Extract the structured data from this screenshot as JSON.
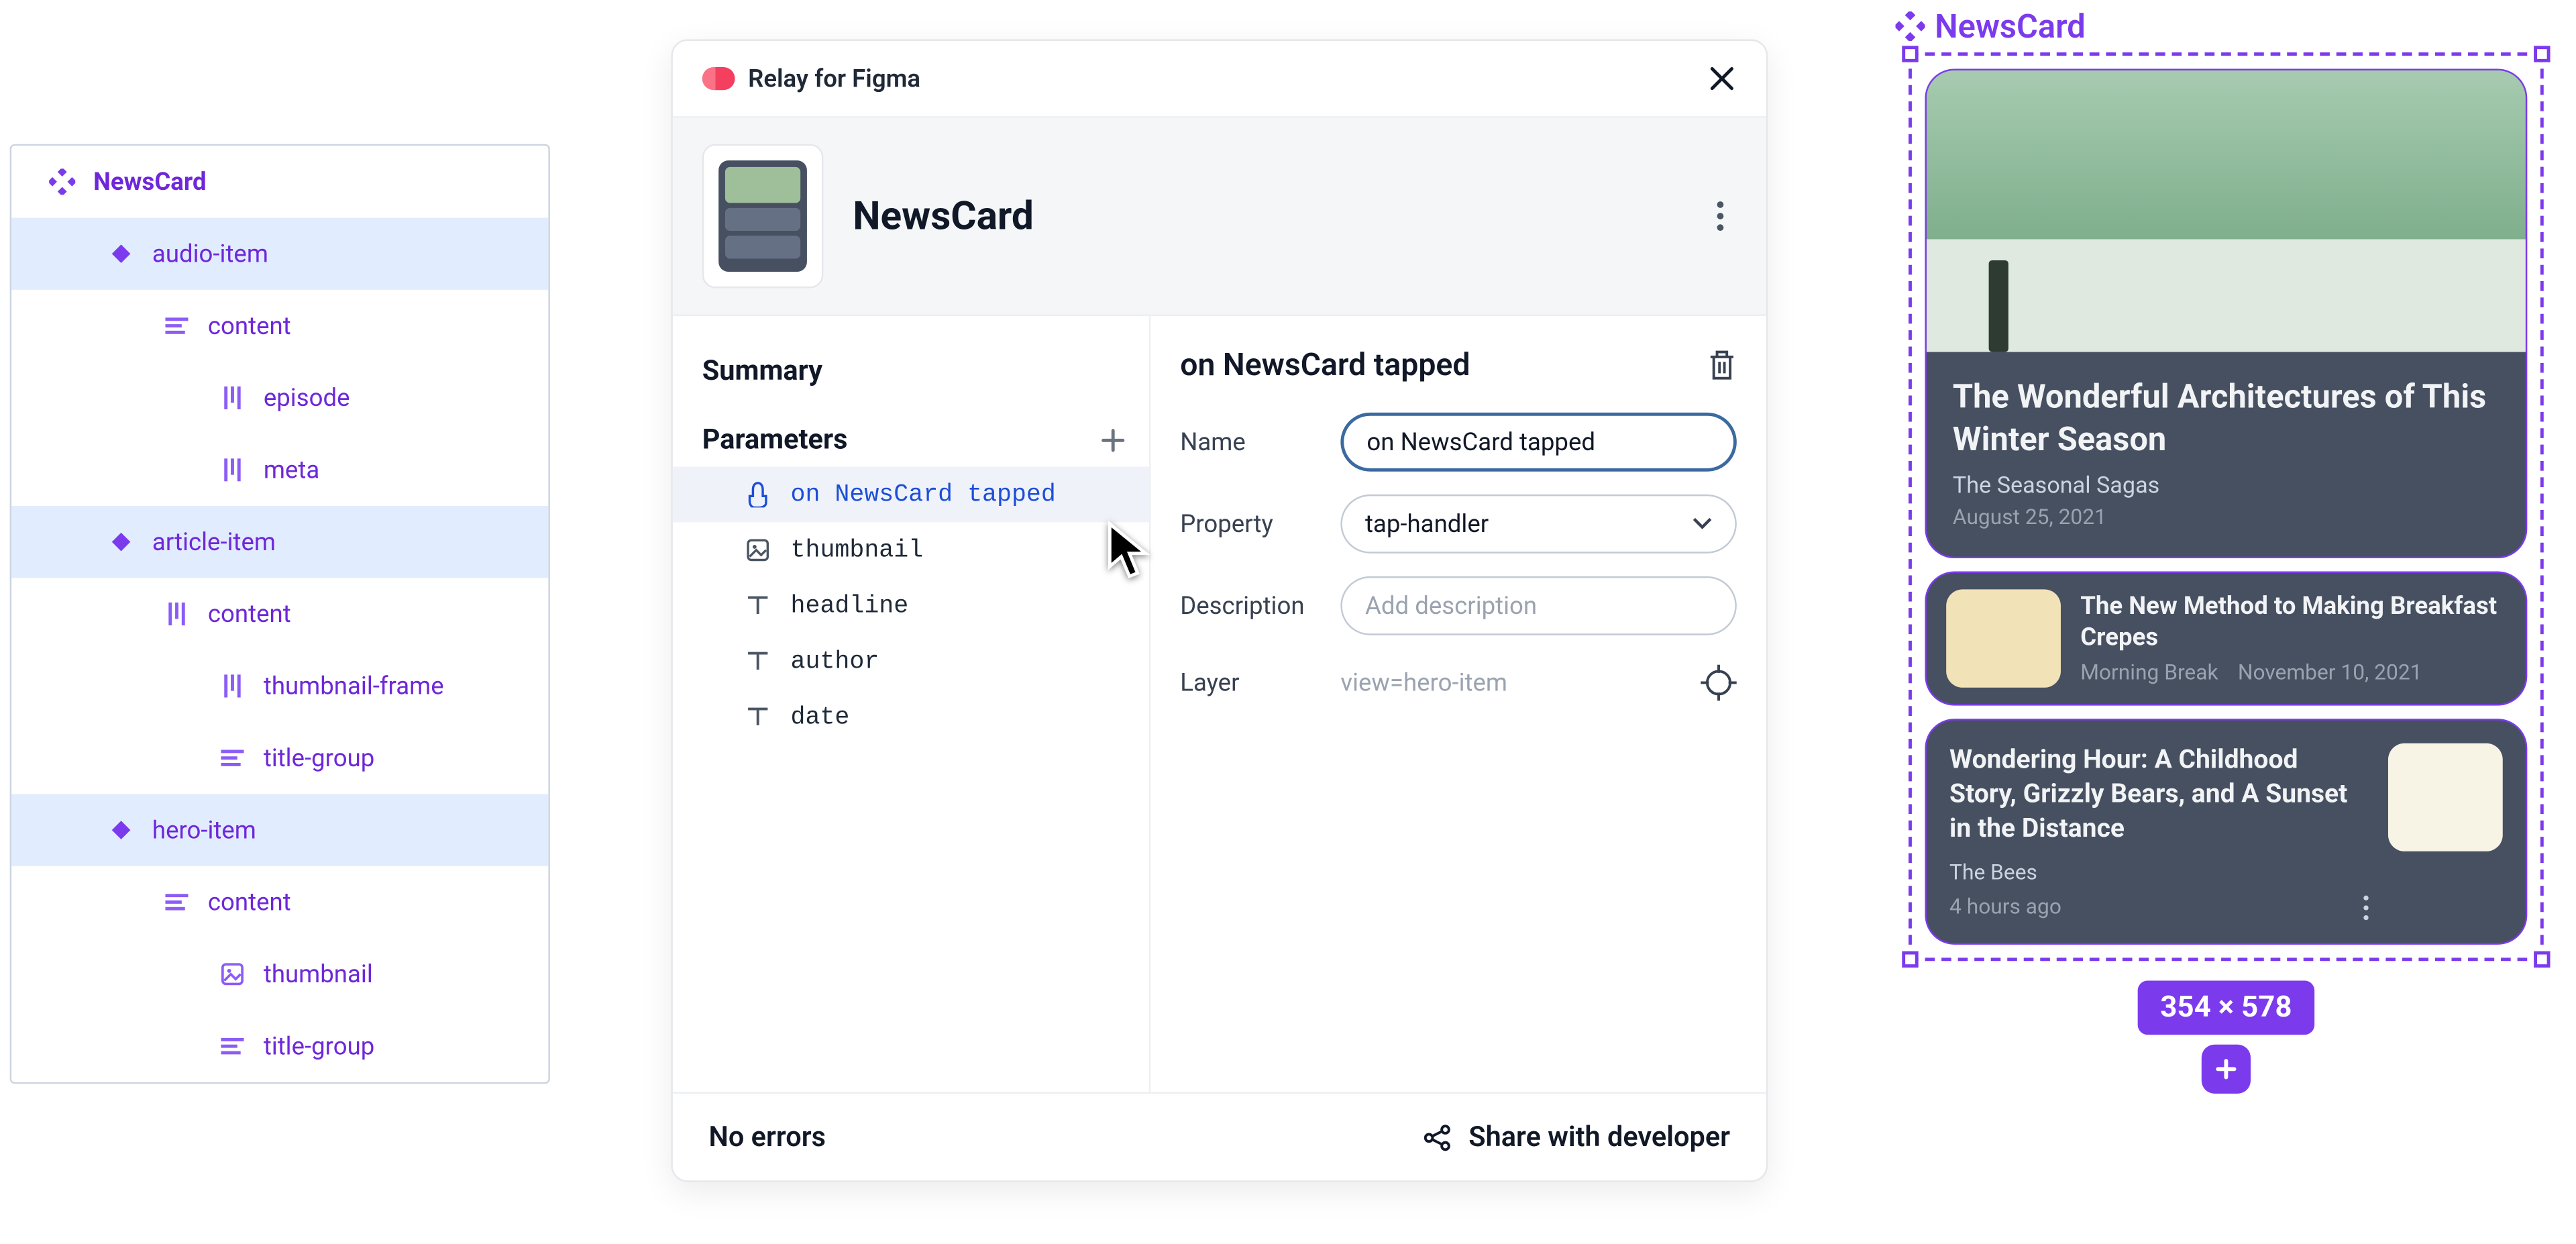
{
  "layers": {
    "root": "NewsCard",
    "items": [
      {
        "label": "audio-item",
        "icon": "diamond",
        "indent": 1,
        "sel": true
      },
      {
        "label": "content",
        "icon": "lines",
        "indent": 2,
        "sel": false
      },
      {
        "label": "episode",
        "icon": "vframe",
        "indent": 3,
        "sel": false
      },
      {
        "label": "meta",
        "icon": "vframe",
        "indent": 3,
        "sel": false
      },
      {
        "label": "article-item",
        "icon": "diamond",
        "indent": 1,
        "sel": true
      },
      {
        "label": "content",
        "icon": "vframe",
        "indent": 2,
        "sel": false
      },
      {
        "label": "thumbnail-frame",
        "icon": "vframe",
        "indent": 3,
        "sel": false
      },
      {
        "label": "title-group",
        "icon": "lines",
        "indent": 3,
        "sel": false
      },
      {
        "label": "hero-item",
        "icon": "diamond",
        "indent": 1,
        "sel": true
      },
      {
        "label": "content",
        "icon": "lines",
        "indent": 2,
        "sel": false
      },
      {
        "label": "thumbnail",
        "icon": "image",
        "indent": 3,
        "sel": false
      },
      {
        "label": "title-group",
        "icon": "lines",
        "indent": 3,
        "sel": false
      }
    ]
  },
  "plugin": {
    "app_name": "Relay for Figma",
    "component_title": "NewsCard",
    "left": {
      "summary_label": "Summary",
      "parameters_label": "Parameters",
      "params": [
        {
          "label": "on NewsCard tapped",
          "icon": "tap",
          "sel": true
        },
        {
          "label": "thumbnail",
          "icon": "image",
          "sel": false
        },
        {
          "label": "headline",
          "icon": "text",
          "sel": false
        },
        {
          "label": "author",
          "icon": "text",
          "sel": false
        },
        {
          "label": "date",
          "icon": "text",
          "sel": false
        }
      ]
    },
    "right": {
      "title": "on NewsCard tapped",
      "name_label": "Name",
      "name_value": "on NewsCard tapped",
      "property_label": "Property",
      "property_value": "tap-handler",
      "description_label": "Description",
      "description_placeholder": "Add description",
      "layer_label": "Layer",
      "layer_value": "view=hero-item"
    },
    "footer": {
      "status": "No errors",
      "share": "Share with developer"
    }
  },
  "canvas": {
    "tag": "NewsCard",
    "size_badge": "354 × 578",
    "hero": {
      "title": "The Wonderful Architectures of This Winter Season",
      "subtitle": "The Seasonal Sagas",
      "date": "August 25, 2021"
    },
    "article": {
      "title": "The New Method to Making Breakfast Crepes",
      "source": "Morning Break",
      "date": "November 10, 2021"
    },
    "audio": {
      "title": "Wondering Hour: A Childhood Story, Grizzly Bears, and A Sunset in the Distance",
      "source": "The Bees",
      "time": "4 hours ago"
    }
  }
}
